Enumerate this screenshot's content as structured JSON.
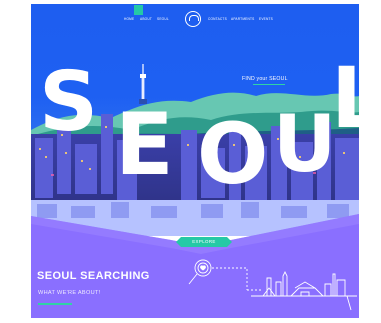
{
  "nav": {
    "items_left": [
      "HOME",
      "ABOUT",
      "SEOUL"
    ],
    "items_right": [
      "CONTACTS",
      "APARTMENTS",
      "EVENTS"
    ]
  },
  "hero": {
    "letters": [
      "S",
      "E",
      "O",
      "U",
      "L"
    ],
    "tagline": "FIND your SEOUL"
  },
  "explore": {
    "label": "EXPLORE"
  },
  "section": {
    "title": "SEOUL SEARCHING",
    "subtitle": "WHAT WE'RE ABOUT!"
  },
  "colors": {
    "sky": "#1e5ef0",
    "accent": "#2fd3a5",
    "purple": "#8a6fff"
  }
}
